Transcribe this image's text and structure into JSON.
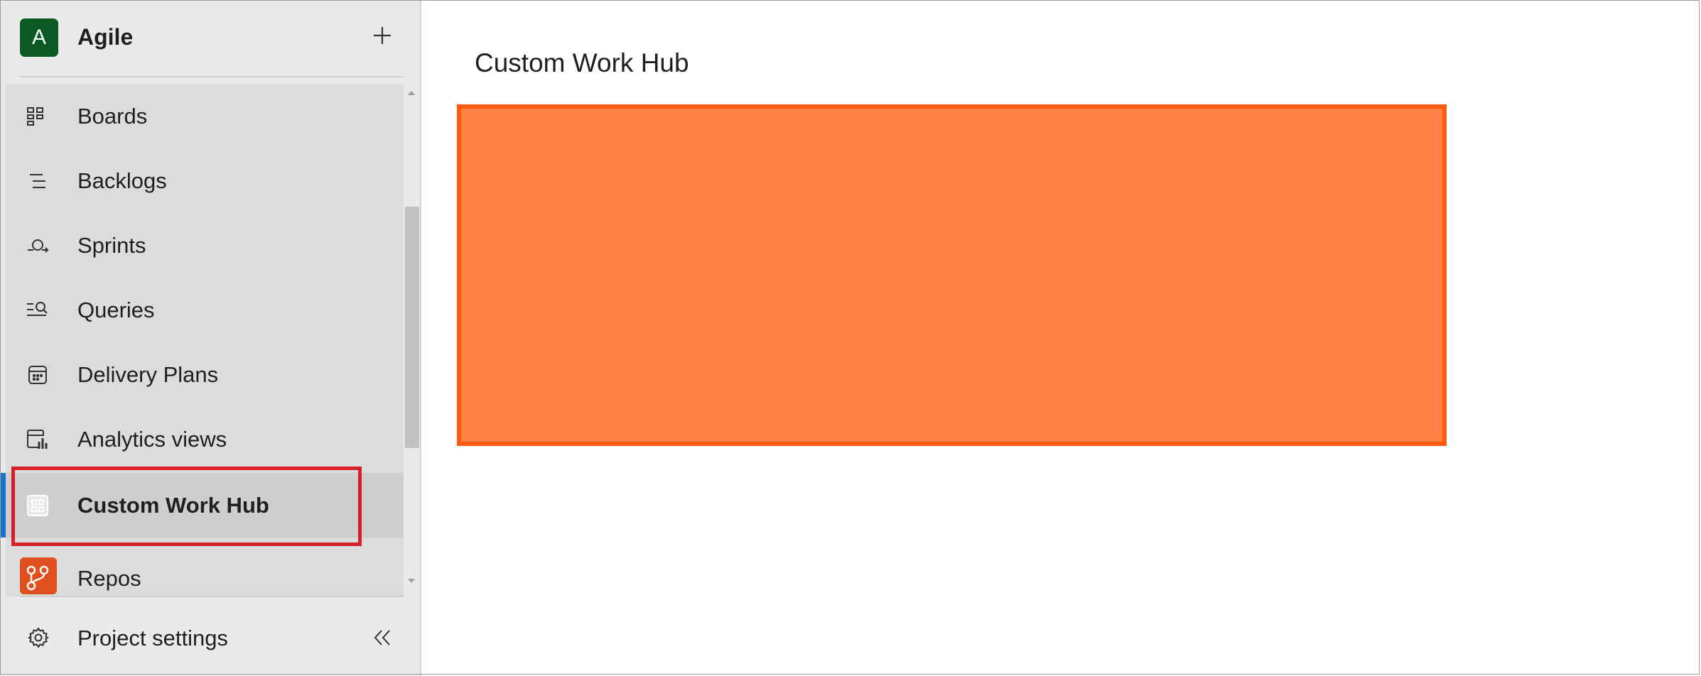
{
  "project": {
    "avatar_letter": "A",
    "name": "Agile"
  },
  "nav": {
    "items": [
      {
        "label": "Boards",
        "icon": "boards-icon"
      },
      {
        "label": "Backlogs",
        "icon": "backlogs-icon"
      },
      {
        "label": "Sprints",
        "icon": "sprints-icon"
      },
      {
        "label": "Queries",
        "icon": "queries-icon"
      },
      {
        "label": "Delivery Plans",
        "icon": "delivery-plans-icon"
      },
      {
        "label": "Analytics views",
        "icon": "analytics-views-icon"
      },
      {
        "label": "Custom Work Hub",
        "icon": "custom-hub-icon",
        "selected": true
      }
    ],
    "repos_label": "Repos",
    "settings_label": "Project settings"
  },
  "main": {
    "title": "Custom Work Hub"
  },
  "colors": {
    "project_avatar": "#0b5a23",
    "selection_bar": "#1a73c8",
    "highlight_border": "#d61f26",
    "orange_fill": "#ff8244",
    "orange_border": "#ff5a10",
    "repos_icon": "#e04f1e"
  }
}
